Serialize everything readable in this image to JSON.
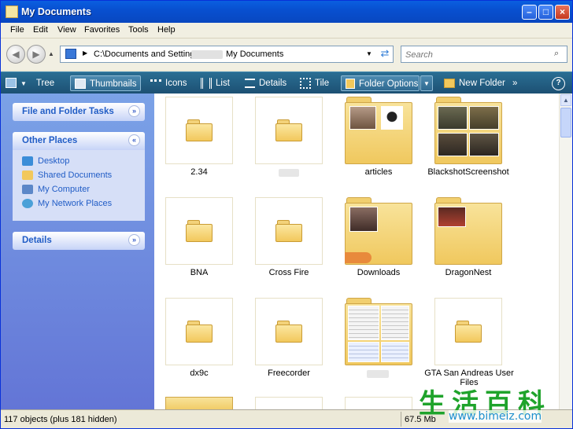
{
  "window": {
    "title": "My Documents"
  },
  "menu": [
    "File",
    "Edit",
    "View",
    "Favorites",
    "Tools",
    "Help"
  ],
  "address": {
    "path": "C:\\Documents and Settings\\",
    "path_tail": "My Documents"
  },
  "search": {
    "placeholder": "Search"
  },
  "toolbar": {
    "tree": "Tree",
    "thumbnails": "Thumbnails",
    "icons": "Icons",
    "list": "List",
    "details": "Details",
    "tile": "Tile",
    "folder_options": "Folder Options",
    "new_folder": "New Folder",
    "more": "»"
  },
  "sidebar": {
    "tasks_title": "File and Folder Tasks",
    "other_places_title": "Other Places",
    "places": [
      "Desktop",
      "Shared Documents",
      "My Computer",
      "My Network Places"
    ],
    "details_title": "Details"
  },
  "items": [
    {
      "name": "2.34"
    },
    {
      "name": ""
    },
    {
      "name": "articles"
    },
    {
      "name": "BlackshotScreenshot"
    },
    {
      "name": "BNA"
    },
    {
      "name": "Cross Fire"
    },
    {
      "name": "Downloads"
    },
    {
      "name": "DragonNest"
    },
    {
      "name": "dx9c"
    },
    {
      "name": "Freecorder"
    },
    {
      "name": ""
    },
    {
      "name": "GTA San Andreas User Files"
    }
  ],
  "status": {
    "objects": "117 objects (plus 181 hidden)",
    "size": "67.5 Mb"
  },
  "watermark": {
    "chars": "生活百科",
    "url": "www.bimeiz.com"
  },
  "colors": {
    "title_bar": "#0a5fe0",
    "toolbar": "#1c4f72",
    "sidebar": "#7ba2e7",
    "folder": "#f2c85c"
  }
}
